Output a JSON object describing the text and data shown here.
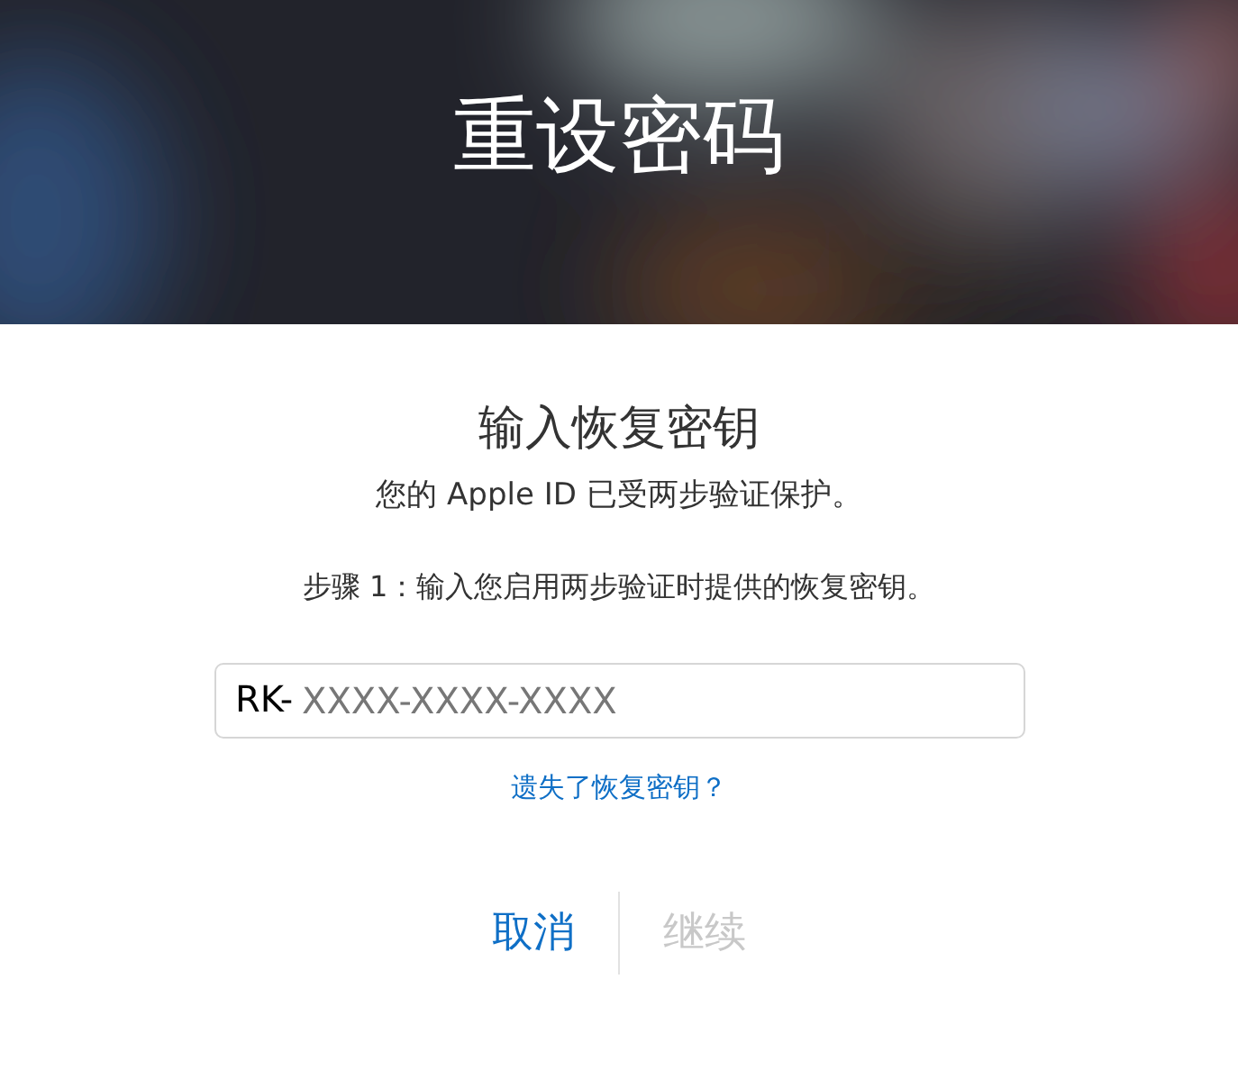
{
  "header": {
    "kind": "picture",
    "title": "重设密码"
  },
  "heading": "输入恢复密钥",
  "subtitle": "您的 Apple ID 已受两步验证保护。",
  "instruction": "步骤 1：输入您启用两步验证时提供的恢复密钥。",
  "key_field": {
    "prefix": "RK-",
    "placeholder": "XXXX-XXXX-XXXX"
  },
  "lost_key_link": "遗失了恢复密钥？",
  "buttons": [
    {
      "label": "取消",
      "disabled": false
    },
    {
      "label": "继续",
      "disabled": true
    }
  ]
}
